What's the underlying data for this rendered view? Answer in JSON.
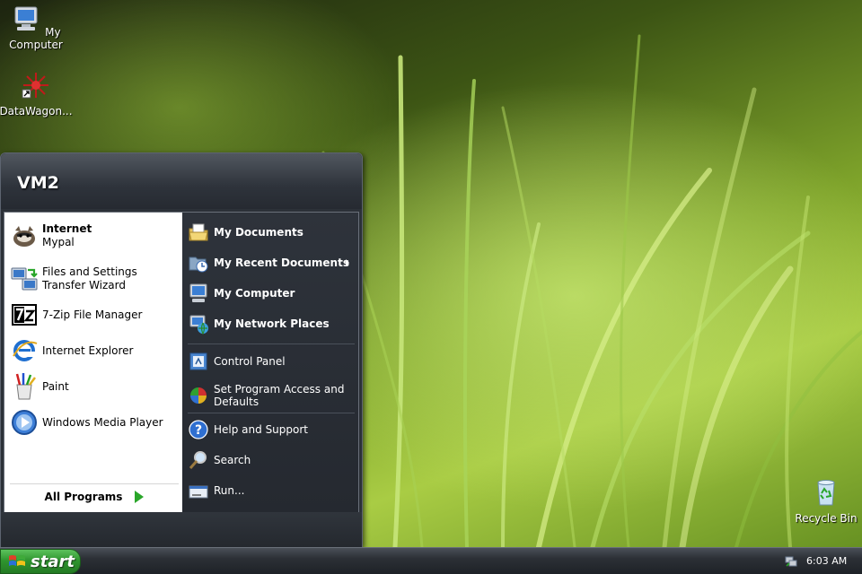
{
  "desktop": {
    "icons": [
      {
        "label": "My Computer",
        "icon": "my-computer-icon"
      },
      {
        "label": "DataWagon...",
        "icon": "datawagon-shortcut-icon"
      },
      {
        "label": "Recycle Bin",
        "icon": "recycle-bin-icon"
      }
    ]
  },
  "start_menu": {
    "user_name": "VM2",
    "pinned": [
      {
        "title": "Internet",
        "subtitle": "Mypal",
        "icon": "mypal-browser-icon"
      }
    ],
    "programs": [
      {
        "label": "Files and Settings Transfer Wizard",
        "icon": "transfer-wizard-icon"
      },
      {
        "label": "7-Zip File Manager",
        "icon": "7zip-icon"
      },
      {
        "label": "Internet Explorer",
        "icon": "internet-explorer-icon"
      },
      {
        "label": "Paint",
        "icon": "paint-icon"
      },
      {
        "label": "Windows Media Player",
        "icon": "media-player-icon"
      }
    ],
    "all_programs_label": "All Programs",
    "places": [
      {
        "label": "My Documents",
        "icon": "my-documents-icon"
      },
      {
        "label": "My Recent Documents",
        "icon": "recent-documents-icon"
      },
      {
        "label": "My Computer",
        "icon": "my-computer-icon"
      },
      {
        "label": "My Network Places",
        "icon": "network-places-icon"
      }
    ],
    "system": [
      {
        "label": "Control Panel",
        "icon": "control-panel-icon"
      },
      {
        "label": "Set Program Access and Defaults",
        "icon": "program-defaults-icon"
      }
    ],
    "tools": [
      {
        "label": "Help and Support",
        "icon": "help-icon"
      },
      {
        "label": "Search",
        "icon": "search-icon"
      },
      {
        "label": "Run...",
        "icon": "run-icon"
      }
    ]
  },
  "taskbar": {
    "start_label": "start",
    "clock": "6:03 AM"
  },
  "colors": {
    "start_button": "#2f962f",
    "menu_dark": "#2c3138",
    "taskbar": "#2c3036"
  }
}
